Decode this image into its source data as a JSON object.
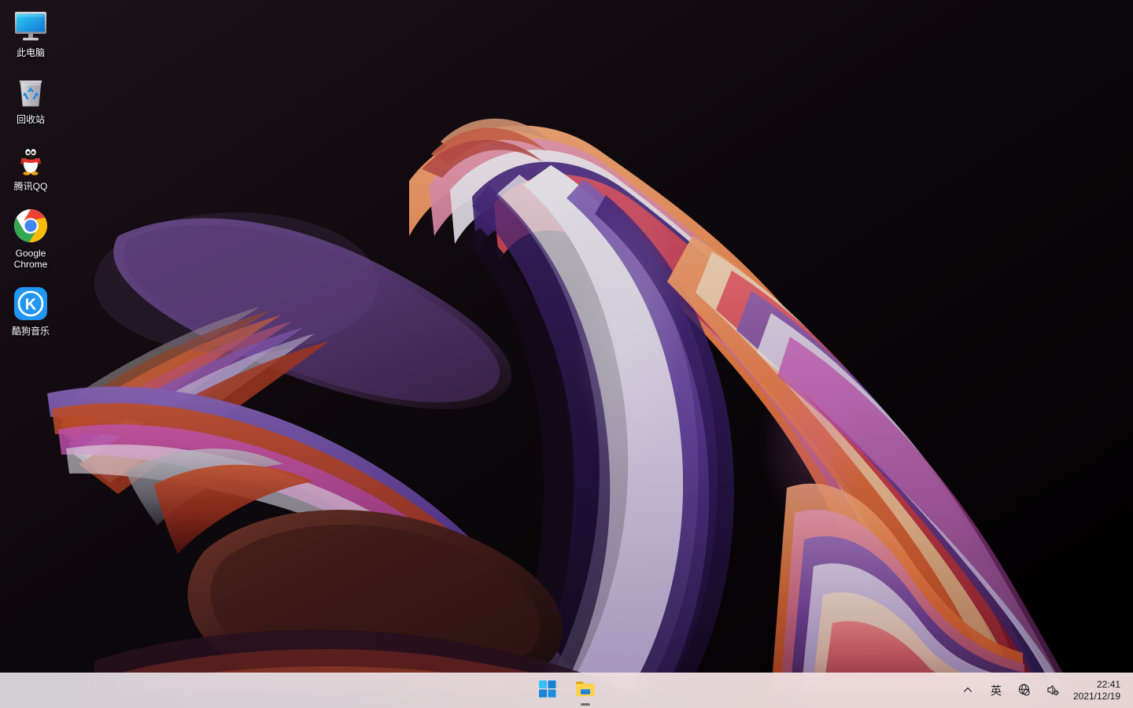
{
  "desktop": {
    "icons": [
      {
        "label": "此电脑",
        "icon": "this-pc-icon"
      },
      {
        "label": "回收站",
        "icon": "recycle-bin-icon"
      },
      {
        "label": "腾讯QQ",
        "icon": "tencent-qq-icon"
      },
      {
        "label": "Google Chrome",
        "icon": "google-chrome-icon"
      },
      {
        "label": "酷狗音乐",
        "icon": "kugou-music-icon"
      }
    ],
    "wallpaper": {
      "name": "abstract-3d-ribbons-wallpaper",
      "background_color": "#060406",
      "palette": [
        "#1a1218",
        "#5a3d79",
        "#7a4a93",
        "#c0392b",
        "#e8643c",
        "#f08a5d",
        "#d94f70",
        "#e8dff5",
        "#f3e6ef",
        "#8e5fa8",
        "#3d2a5c"
      ]
    }
  },
  "taskbar": {
    "background_color": "#ebe1e6",
    "buttons": [
      {
        "name": "start-button",
        "label": "开始",
        "active": false
      },
      {
        "name": "file-explorer-button",
        "label": "文件资源管理器",
        "active": true
      }
    ],
    "tray": {
      "show_hidden_icons": {
        "label": "显示隐藏的图标",
        "icon": "chevron-up-icon"
      },
      "ime": {
        "label": "英",
        "icon": "ime-english-icon"
      },
      "network": {
        "label": "网络",
        "icon": "network-disconnected-icon"
      },
      "volume": {
        "label": "音量",
        "icon": "speaker-muted-icon"
      },
      "clock": {
        "time": "22:41",
        "date": "2021/12/19"
      }
    }
  }
}
